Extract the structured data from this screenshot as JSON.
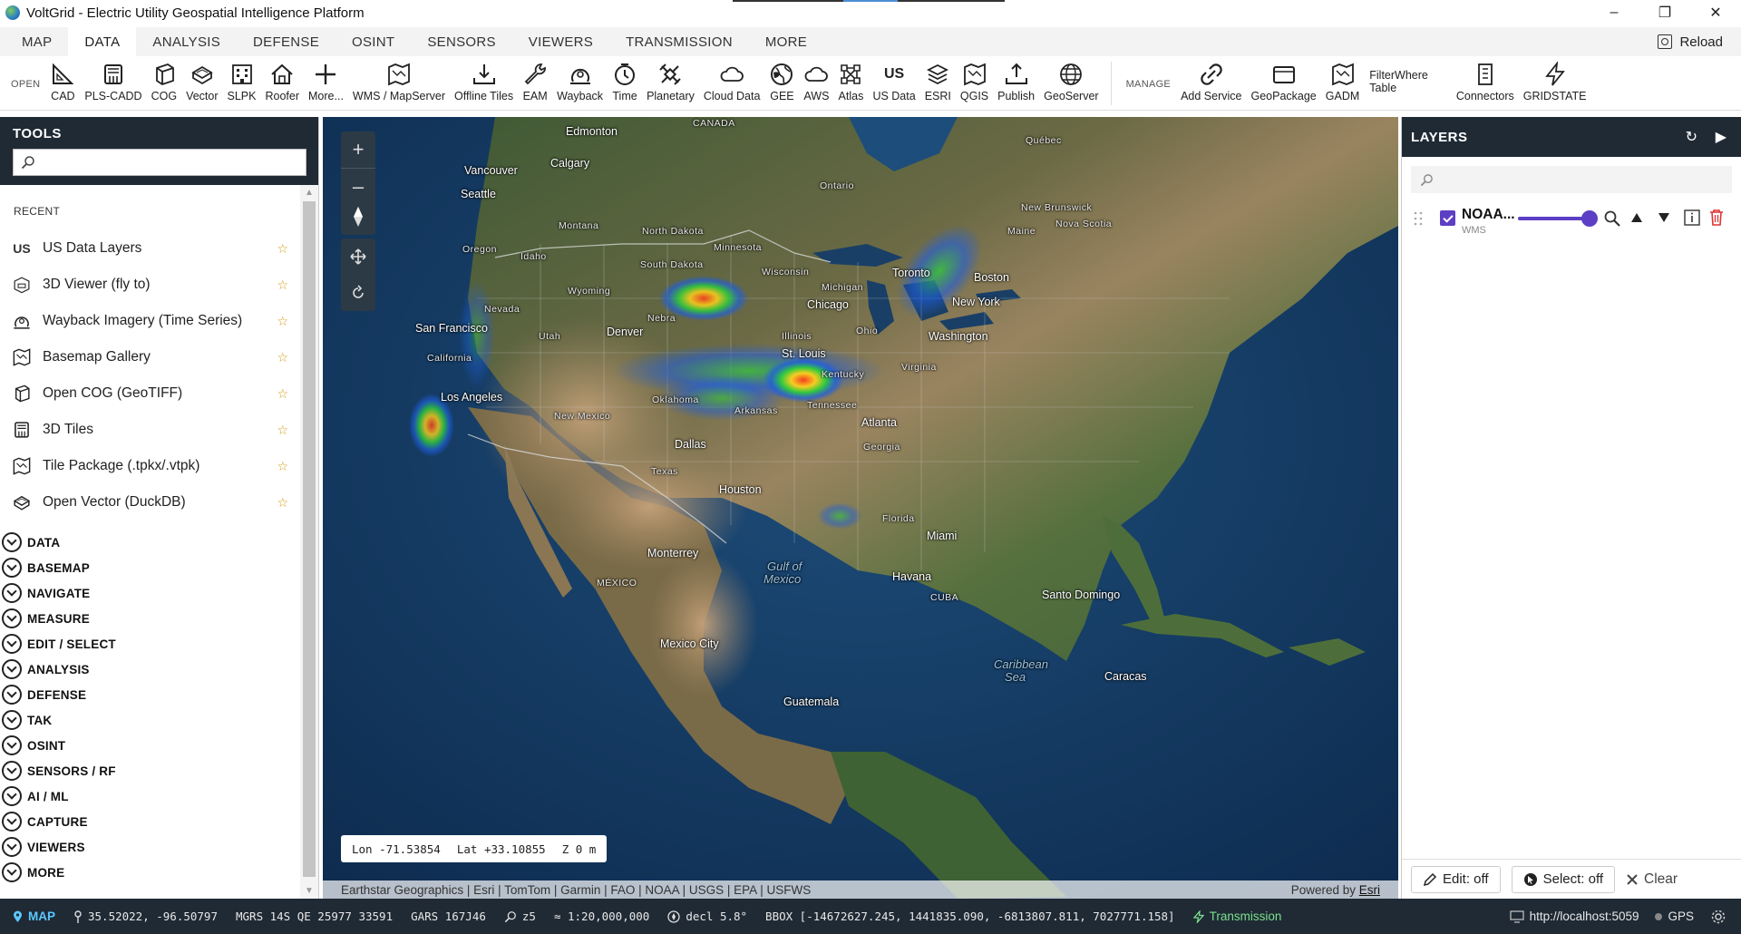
{
  "window": {
    "title": "VoltGrid - Electric Utility Geospatial Intelligence Platform",
    "minimize": "–",
    "restore": "❐",
    "close": "✕"
  },
  "menu": {
    "tabs": [
      "MAP",
      "DATA",
      "ANALYSIS",
      "DEFENSE",
      "OSINT",
      "SENSORS",
      "VIEWERS",
      "TRANSMISSION",
      "MORE"
    ],
    "active": "DATA",
    "reload_label": "Reload"
  },
  "toolbar": {
    "open_label": "OPEN",
    "manage_label": "MANAGE",
    "open_buttons": [
      {
        "label": "CAD",
        "icon": "cad-icon"
      },
      {
        "label": "PLS-CADD",
        "icon": "tower-icon"
      },
      {
        "label": "COG",
        "icon": "cube-icon"
      },
      {
        "label": "Vector",
        "icon": "vector-icon"
      },
      {
        "label": "SLPK",
        "icon": "building-icon"
      },
      {
        "label": "Roofer",
        "icon": "house-icon"
      },
      {
        "label": "More...",
        "icon": "plus-icon"
      },
      {
        "label": "WMS / MapServer",
        "icon": "map-icon"
      },
      {
        "label": "Offline Tiles",
        "icon": "download-tray-icon"
      },
      {
        "label": "EAM",
        "icon": "wrench-icon"
      },
      {
        "label": "Wayback",
        "icon": "wayback-icon"
      },
      {
        "label": "Time",
        "icon": "clock-icon"
      },
      {
        "label": "Planetary",
        "icon": "satellite-icon"
      },
      {
        "label": "Cloud Data",
        "icon": "cloud-icon"
      },
      {
        "label": "GEE",
        "icon": "globe-icon"
      },
      {
        "label": "AWS",
        "icon": "cloud-icon"
      },
      {
        "label": "Atlas",
        "icon": "atlas-icon"
      },
      {
        "label": "US Data",
        "icon": "us-text-icon",
        "glyph": "US"
      },
      {
        "label": "ESRI",
        "icon": "layers-icon"
      },
      {
        "label": "QGIS",
        "icon": "map-icon"
      },
      {
        "label": "Publish",
        "icon": "upload-tray-icon"
      },
      {
        "label": "GeoServer",
        "icon": "globe-grid-icon"
      }
    ],
    "manage_buttons": [
      {
        "label": "Add Service",
        "icon": "link-icon"
      },
      {
        "label": "GeoPackage",
        "icon": "package-icon"
      },
      {
        "label": "GADM",
        "icon": "map-icon"
      }
    ],
    "filter_where": {
      "line1": "FilterWhere",
      "line2": "Table"
    },
    "end_buttons": [
      {
        "label": "Connectors",
        "icon": "connector-icon"
      },
      {
        "label": "GRIDSTATE",
        "icon": "lightning-icon"
      }
    ]
  },
  "tools": {
    "title": "TOOLS",
    "search_placeholder": "",
    "recent_label": "RECENT",
    "recent": [
      {
        "label": "US Data Layers",
        "icon": "us-text-icon",
        "glyph": "US"
      },
      {
        "label": "3D Viewer (fly to)",
        "icon": "viewer3d-icon"
      },
      {
        "label": "Wayback Imagery (Time Series)",
        "icon": "wayback-icon"
      },
      {
        "label": "Basemap Gallery",
        "icon": "map-icon"
      },
      {
        "label": "Open COG (GeoTIFF)",
        "icon": "cube-icon"
      },
      {
        "label": "3D Tiles",
        "icon": "tower-icon"
      },
      {
        "label": "Tile Package (.tpkx/.vtpk)",
        "icon": "map-icon"
      },
      {
        "label": "Open Vector (DuckDB)",
        "icon": "vector-icon"
      }
    ],
    "star": "☆",
    "sections": [
      "DATA",
      "BASEMAP",
      "NAVIGATE",
      "MEASURE",
      "EDIT / SELECT",
      "ANALYSIS",
      "DEFENSE",
      "TAK",
      "OSINT",
      "SENSORS / RF",
      "AI / ML",
      "CAPTURE",
      "VIEWERS",
      "MORE"
    ]
  },
  "map": {
    "zoom_in": "+",
    "zoom_out": "–",
    "coords": {
      "lon": "Lon -71.53854",
      "lat": "Lat +33.10855",
      "z": "Z 0 m"
    },
    "attribution": "Earthstar Geographics | Esri | TomTom | Garmin | FAO | NOAA | USGS | EPA | USFWS",
    "powered_prefix": "Powered by",
    "powered_link": "Esri",
    "places": {
      "canada": "CANADA",
      "edmonton": "Edmonton",
      "calgary": "Calgary",
      "vancouver": "Vancouver",
      "seattle": "Seattle",
      "ontario": "Ontario",
      "quebec": "Québec",
      "montana": "Montana",
      "north_dakota": "North Dakota",
      "south_dakota": "South Dakota",
      "minnesota": "Minnesota",
      "wisconsin": "Wisconsin",
      "michigan": "Michigan",
      "wyoming": "Wyoming",
      "oregon": "Oregon",
      "idaho": "Idaho",
      "nevada": "Nevada",
      "utah": "Utah",
      "denver": "Denver",
      "nebraska": "Nebra",
      "san_francisco": "San Francisco",
      "california": "California",
      "los_angeles": "Los Angeles",
      "chicago": "Chicago",
      "toronto": "Toronto",
      "new_york": "New York",
      "boston": "Boston",
      "washington": "Washington",
      "ohio": "Ohio",
      "illinois": "Illinois",
      "st_louis": "St. Louis",
      "kentucky": "Kentucky",
      "virginia": "Virginia",
      "tennessee": "Tennessee",
      "oklahoma": "Oklahoma",
      "arkansas": "Arkansas",
      "new_mexico": "New Mexico",
      "dallas": "Dallas",
      "texas": "Texas",
      "houston": "Houston",
      "atlanta": "Atlanta",
      "georgia": "Georgia",
      "florida": "Florida",
      "miami": "Miami",
      "monterrey": "Monterrey",
      "mexico": "MÉXICO",
      "gulf_1": "Gulf of",
      "gulf_2": "Mexico",
      "havana": "Havana",
      "cuba": "CUBA",
      "santo_domingo": "Santo Domingo",
      "mexico_city": "Mexico City",
      "caribbean_1": "Caribbean",
      "caribbean_2": "Sea",
      "guatemala": "Guatemala",
      "caracas": "Caracas",
      "maine": "Maine",
      "new_brunswick": "New Brunswick",
      "nova_scotia": "Nova Scotia"
    }
  },
  "layers": {
    "title": "LAYERS",
    "refresh": "↻",
    "collapse": "▶",
    "search_placeholder": "",
    "items": [
      {
        "name": "NOAA...",
        "type": "WMS",
        "visible": true,
        "opacity": 1.0
      }
    ],
    "edit_label": "Edit: off",
    "select_label": "Select: off",
    "clear_label": "Clear"
  },
  "status": {
    "mode": "MAP",
    "latlon": "35.52022, -96.50797",
    "mgrs": "MGRS 14S QE 25977 33591",
    "gars": "GARS 167J46",
    "zoom": "z5",
    "scale": "≈ 1:20,000,000",
    "decl": "decl 5.8°",
    "bbox": "BBOX [-14672627.245, 1441835.090, -6813807.811, 7027771.158]",
    "transmission": "Transmission",
    "server": "http://localhost:5059",
    "gps": "GPS"
  },
  "colors": {
    "panel_header": "#1f2a35",
    "accent_purple": "#5c3fc4",
    "status_map": "#5cc8ff",
    "status_transmission": "#7be08d",
    "star": "#d49a10"
  }
}
